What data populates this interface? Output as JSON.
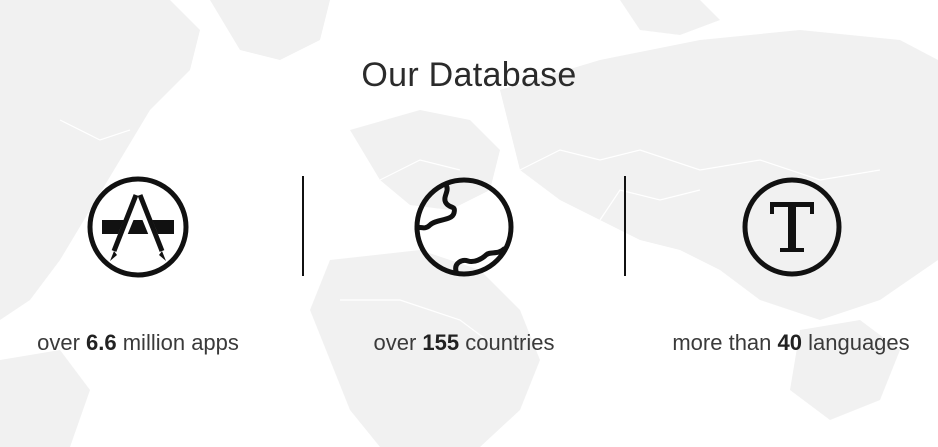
{
  "section": {
    "title": "Our Database"
  },
  "stats": [
    {
      "prefix": "over ",
      "value": "6.6",
      "suffix": " million apps",
      "icon": "app-store-icon"
    },
    {
      "prefix": "over ",
      "value": "155",
      "suffix": " countries",
      "icon": "globe-icon"
    },
    {
      "prefix": "more than ",
      "value": "40",
      "suffix": " languages",
      "icon": "language-t-icon"
    }
  ],
  "colors": {
    "text": "#3a3a3a",
    "icon": "#111111",
    "map": "#f0f0f0"
  }
}
